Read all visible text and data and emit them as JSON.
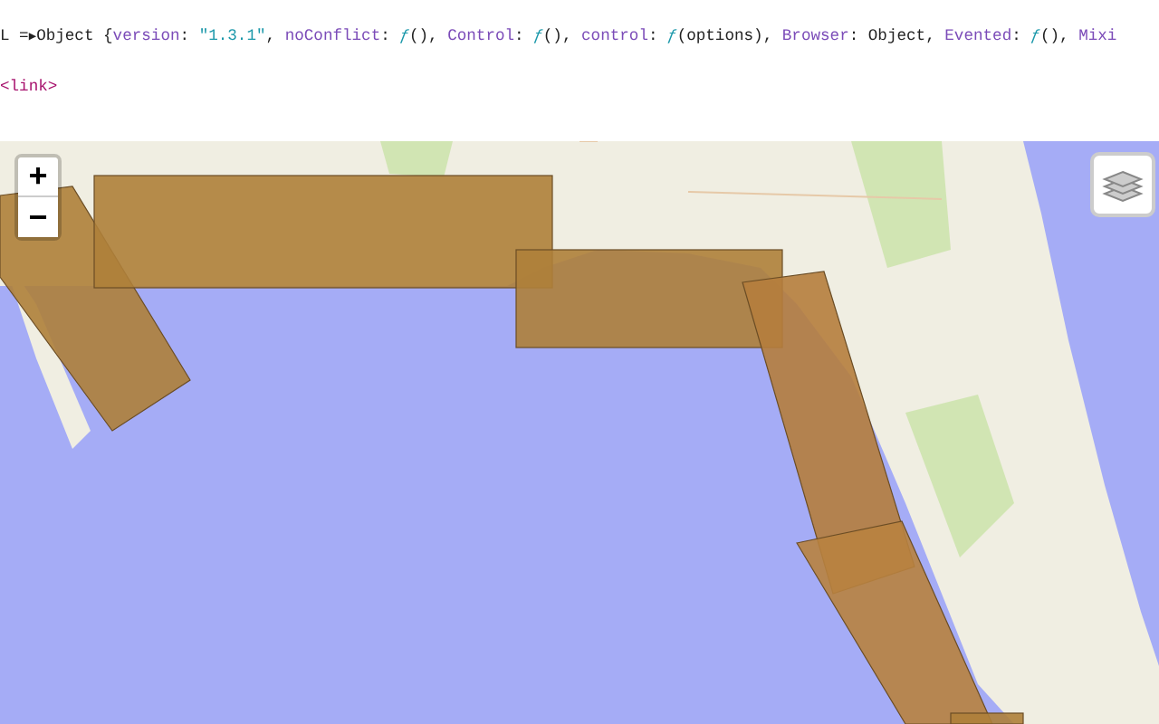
{
  "console": {
    "variable": "L",
    "operator": "=",
    "toggle": "▶",
    "tokens": [
      {
        "text": "Object {",
        "kind": "plain"
      },
      {
        "text": "version",
        "kind": "key"
      },
      {
        "text": ": ",
        "kind": "plain"
      },
      {
        "text": "\"1.3.1\"",
        "kind": "string"
      },
      {
        "text": ", ",
        "kind": "plain"
      },
      {
        "text": "noConflict",
        "kind": "key"
      },
      {
        "text": ": ",
        "kind": "plain"
      },
      {
        "text": "ƒ",
        "kind": "fn"
      },
      {
        "text": "(), ",
        "kind": "plain"
      },
      {
        "text": "Control",
        "kind": "key"
      },
      {
        "text": ": ",
        "kind": "plain"
      },
      {
        "text": "ƒ",
        "kind": "fn"
      },
      {
        "text": "(), ",
        "kind": "plain"
      },
      {
        "text": "control",
        "kind": "key"
      },
      {
        "text": ": ",
        "kind": "plain"
      },
      {
        "text": "ƒ",
        "kind": "fn"
      },
      {
        "text": "(options), ",
        "kind": "plain"
      },
      {
        "text": "Browser",
        "kind": "key"
      },
      {
        "text": ": Object, ",
        "kind": "plain"
      },
      {
        "text": "Evented",
        "kind": "key"
      },
      {
        "text": ": ",
        "kind": "plain"
      },
      {
        "text": "ƒ",
        "kind": "fn"
      },
      {
        "text": "(), ",
        "kind": "plain"
      },
      {
        "text": "Mixi",
        "kind": "key"
      }
    ]
  },
  "element_tag": "<link>",
  "map": {
    "zoom_in": "+",
    "zoom_out": "−"
  }
}
